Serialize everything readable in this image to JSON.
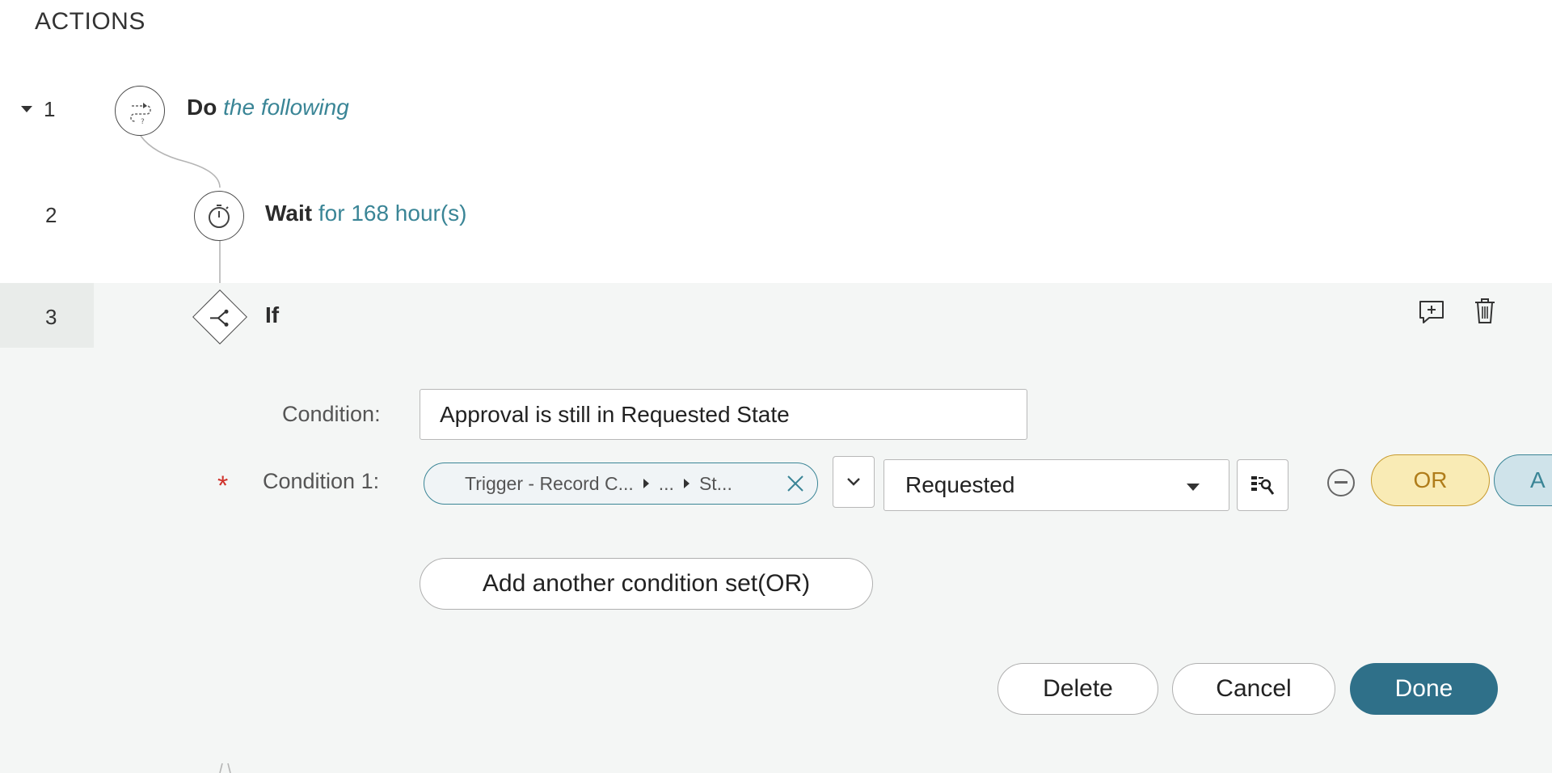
{
  "section": {
    "title": "ACTIONS"
  },
  "steps": [
    {
      "number": "1",
      "keyword": "Do",
      "detail": "the following",
      "icon": "flow-loop-icon"
    },
    {
      "number": "2",
      "keyword": "Wait",
      "detail": "for 168 hour(s)",
      "icon": "stopwatch-icon"
    },
    {
      "number": "3",
      "keyword": "If",
      "detail": "",
      "icon": "branch-decision-icon"
    }
  ],
  "if_panel": {
    "condition_label": "Condition:",
    "condition_value": "Approval is still in Requested State",
    "condition1_label": "Condition 1:",
    "required_mark": "*",
    "pill_segments": [
      "Trigger - Record C...",
      "...",
      "St..."
    ],
    "operator_icon": "chevron-down-icon",
    "value_selected": "Requested",
    "or_label": "OR",
    "and_label": "A",
    "add_set_label": "Add another condition set(OR)",
    "delete_label": "Delete",
    "cancel_label": "Cancel",
    "done_label": "Done"
  },
  "icons": {
    "add_comment": "add-comment-icon",
    "delete_step": "trash-icon",
    "clear_pill": "close-icon",
    "data_picker": "data-pill-picker-icon",
    "remove_condition": "minus-circle-icon"
  },
  "colors": {
    "accent": "#3a8596",
    "primary_button": "#2f7089",
    "or_fill": "#f9ebb5",
    "or_border": "#c79a2d",
    "required": "#d0322b",
    "panel_bg": "#f4f6f5"
  }
}
